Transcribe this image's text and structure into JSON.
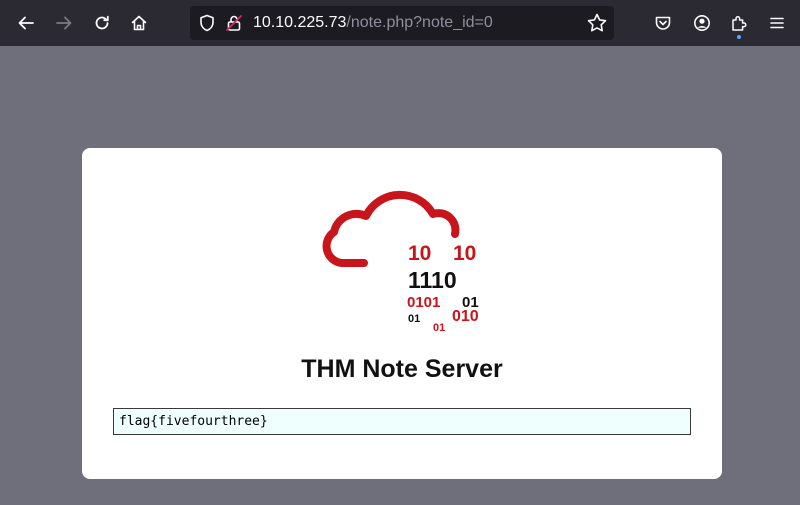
{
  "browser": {
    "url_host": "10.10.225.73",
    "url_path": "/note.php?note_id=0",
    "icons": {
      "back": "arrow-left-icon",
      "forward": "arrow-right-icon",
      "reload": "reload-icon",
      "home": "home-icon",
      "shield": "tracking-protection-shield-icon",
      "lock": "insecure-lock-icon",
      "bookmark": "star-icon",
      "pocket": "pocket-icon",
      "account": "account-icon",
      "extensions": "puzzle-piece-icon",
      "menu": "hamburger-menu-icon"
    }
  },
  "page": {
    "logo": {
      "binary_lines": [
        "10",
        "10",
        "1110",
        "0101",
        "01",
        "01",
        "010",
        "01"
      ],
      "colors": {
        "red": "#c8141b",
        "dark": "#111111"
      }
    },
    "title": "THM Note Server",
    "note_value": "flag{fivefourthree}"
  },
  "colors": {
    "toolbar_bg": "#2b2a33",
    "urlbar_bg": "#1c1b22",
    "page_bg": "#6f6f7c",
    "card_bg": "#ffffff",
    "input_bg": "#eefffe"
  }
}
